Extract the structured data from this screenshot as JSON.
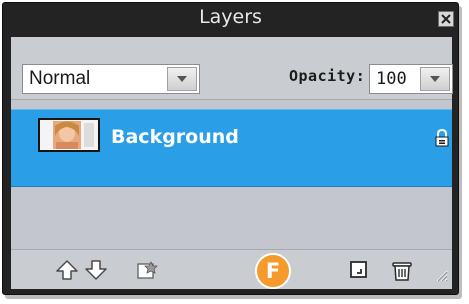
{
  "panel": {
    "title": "Layers",
    "close_icon": "close-icon"
  },
  "blend_mode": {
    "value": "Normal",
    "dropdown_icon": "chevron-down-icon"
  },
  "opacity": {
    "label": "Opacity:",
    "value": "100",
    "dropdown_icon": "chevron-down-icon"
  },
  "layers": [
    {
      "name": "Background",
      "selected": true,
      "locked": true,
      "thumbnail_icon": "portrait-thumbnail"
    }
  ],
  "toolbar": {
    "icons": [
      "arrow-up-icon",
      "arrow-down-icon",
      "layer-style-icon",
      "new-layer-icon",
      "trash-icon"
    ]
  },
  "badge": {
    "label": "F"
  },
  "colors": {
    "selection": "#2a9ee6",
    "panel_bg": "#c3c7cd",
    "frame": "#232323",
    "badge": "#f59a2b"
  }
}
